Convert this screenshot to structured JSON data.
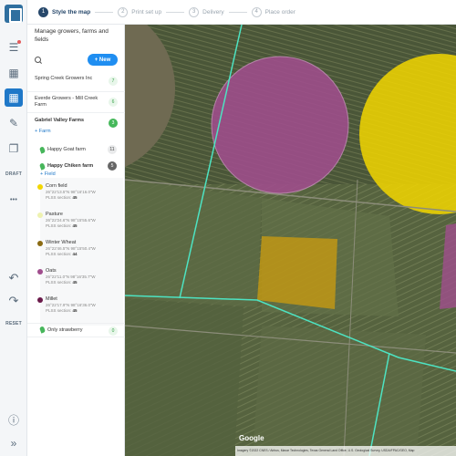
{
  "stepper": {
    "steps": [
      {
        "num": "1",
        "label": "Style the map"
      },
      {
        "num": "2",
        "label": "Print set up"
      },
      {
        "num": "3",
        "label": "Delivery"
      },
      {
        "num": "4",
        "label": "Place order"
      }
    ]
  },
  "rail": {
    "draft_label": "DRAFT",
    "more_label": "•••",
    "reset_label": "RESET"
  },
  "panel": {
    "title": "Manage growers, farms and fields",
    "new_label": "+ New",
    "growers": [
      {
        "name": "Spring Creek Growers Inc",
        "count": "7"
      },
      {
        "name": "Everde Growers - Mill Creek Farm",
        "count": "6"
      },
      {
        "name": "Gabriel Valley Farms",
        "count": "3"
      }
    ],
    "add_farm_label": "Farm",
    "farms": [
      {
        "name": "Happy Goat farm",
        "count": "11"
      },
      {
        "name": "Happy Chiken farm",
        "count": "5"
      }
    ],
    "add_field_label": "Field",
    "fields": [
      {
        "name": "Corn field",
        "coord": "26°22'13.5\"N 98°16'16.0\"W",
        "plss_label": "PLSS section:",
        "plss": "45",
        "color": "#f2d600"
      },
      {
        "name": "Pasture",
        "coord": "26°22'24.6\"N 98°15'55.6\"W",
        "plss_label": "PLSS section:",
        "plss": "45",
        "color": "#eef2b0"
      },
      {
        "name": "Winter Wheat",
        "coord": "26°22'46.5\"N 98°15'50.4\"W",
        "plss_label": "PLSS section:",
        "plss": "44",
        "color": "#8a6a12"
      },
      {
        "name": "Oats",
        "coord": "26°22'11.0\"N 98°16'35.7\"W",
        "plss_label": "PLSS section:",
        "plss": "45",
        "color": "#a04d8d"
      },
      {
        "name": "Millet",
        "coord": "26°22'17.9\"N 98°16'36.0\"W",
        "plss_label": "PLSS section:",
        "plss": "45",
        "color": "#6a1a4a"
      }
    ],
    "last_farm": {
      "name": "Only strawberry",
      "count": "0"
    }
  },
  "map": {
    "google_label": "Google",
    "attribution": "Imagery ©2022 CNES / Airbus, Maxar Technologies, Texas General Land Office, U.S. Geological Survey, USDA/FPAC/GEO, Map"
  },
  "colors": {
    "accent": "#1f8ef1",
    "boundary": "#4de3c2",
    "oats": "#a04d8d",
    "corn": "#f2d600",
    "wheat": "#c69a12"
  }
}
